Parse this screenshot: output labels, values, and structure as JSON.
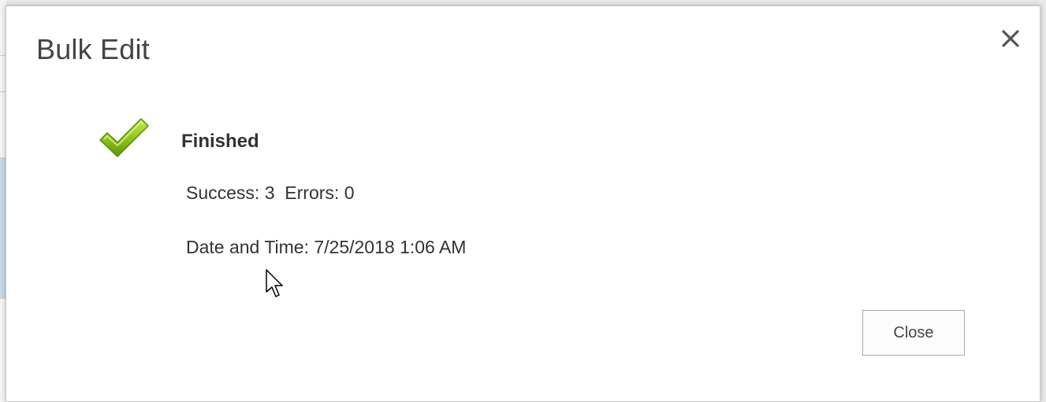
{
  "dialog": {
    "title": "Bulk Edit",
    "status_label": "Finished",
    "success_label": "Success:",
    "success_count": "3",
    "errors_label": "Errors:",
    "errors_count": "0",
    "datetime_label": "Date and Time:",
    "datetime_value": "7/25/2018 1:06 AM",
    "close_button_label": "Close"
  },
  "icons": {
    "close": "close-icon",
    "status": "checkmark-icon",
    "pointer": "mouse-cursor"
  },
  "colors": {
    "check_green": "#8cc21a",
    "text": "#333333",
    "title": "#444444"
  }
}
